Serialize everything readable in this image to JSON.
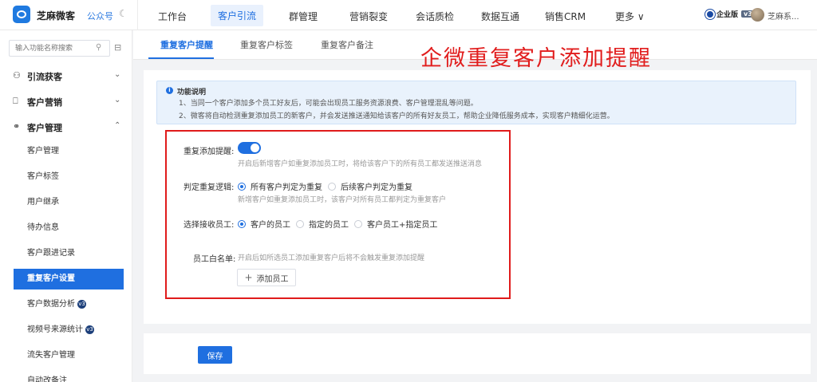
{
  "header": {
    "app_name": "芝麻微客",
    "gzh": "公众号",
    "nav": [
      "工作台",
      "客户引流",
      "群管理",
      "营销裂变",
      "会话质检",
      "数据互通",
      "销售CRM",
      "更多 ∨"
    ],
    "edition": "企业版",
    "edition_version": "v3",
    "user": "芝麻系..."
  },
  "sidebar": {
    "search_placeholder": "输入功能名称搜索",
    "sections": [
      {
        "label": "引流获客",
        "icon": "user-plus-icon"
      },
      {
        "label": "客户营销",
        "icon": "bookmark-icon"
      },
      {
        "label": "客户管理",
        "icon": "users-icon"
      }
    ],
    "items": [
      "客户管理",
      "客户标签",
      "用户继承",
      "待办信息",
      "客户跟进记录",
      "重复客户设置",
      "客户数据分析",
      "视频号来源统计",
      "流失客户管理",
      "自动改备注"
    ],
    "badge": "v3"
  },
  "tabs": [
    "重复客户提醒",
    "重复客户标签",
    "重复客户备注"
  ],
  "overlay_title": "企微重复客户添加提醒",
  "notice": {
    "title": "功能说明",
    "lines": [
      "1、当同一个客户添加多个员工好友后，可能会出现员工服务资源浪费、客户管理混乱等问题。",
      "2、微客将自动检测重复添加员工的新客户，并会发送推送通知给该客户的所有好友员工，帮助企业降低服务成本，实现客户精细化运营。"
    ]
  },
  "form": {
    "repeat_label": "重复添加提醒:",
    "repeat_enabled": true,
    "repeat_hint": "开启后新增客户如重复添加员工时，将给该客户下的所有员工都发送推送消息",
    "logic_label": "判定重复逻辑:",
    "logic_options": [
      "所有客户判定为重复",
      "后续客户判定为重复"
    ],
    "logic_selected": "所有客户判定为重复",
    "logic_hint": "新增客户如重复添加员工时，该客户对所有员工都判定为重复客户",
    "receiver_label": "选择接收员工:",
    "receiver_options": [
      "客户的员工",
      "指定的员工",
      "客户员工+指定员工"
    ],
    "receiver_selected": "客户的员工",
    "whitelist_label": "员工白名单:",
    "whitelist_hint": "开启后如所选员工添加重复客户后将不会触发重复添加提醒",
    "add_button": "添加员工"
  },
  "save_button": "保存",
  "colors": {
    "primary": "#1f6fe0",
    "annotation_red": "#e01b1b"
  }
}
